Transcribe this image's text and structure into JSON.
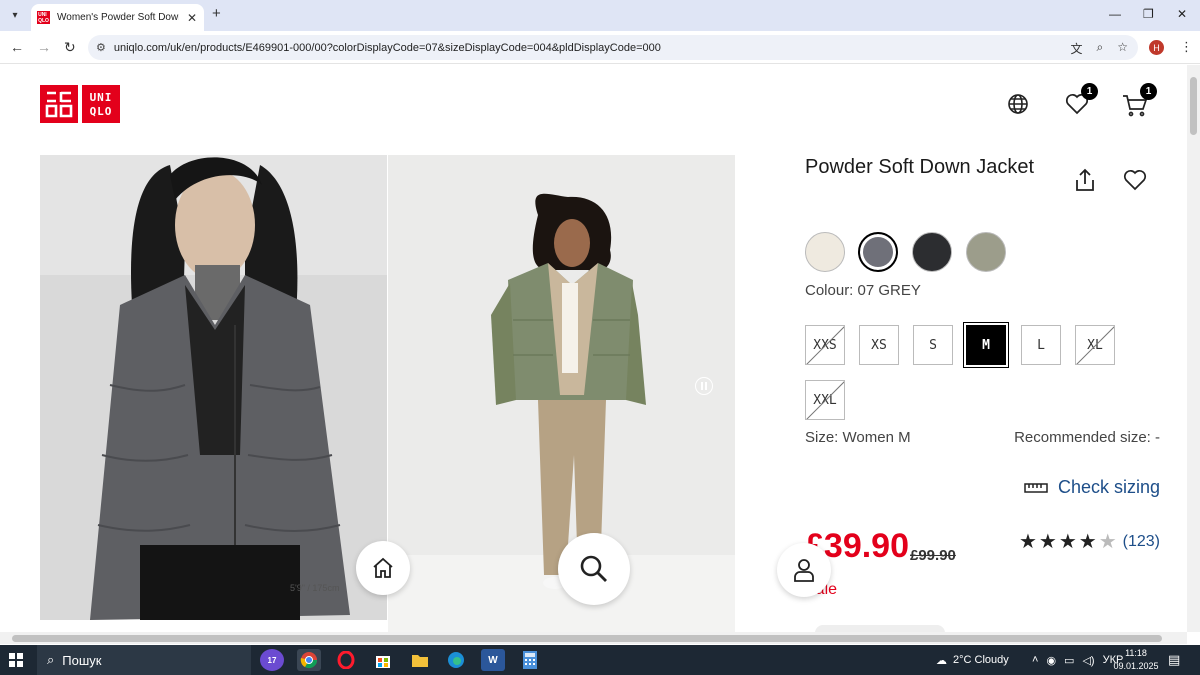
{
  "browser": {
    "tab_title": "Women's Powder Soft Down Ja",
    "url": "uniqlo.com/uk/en/products/E469901-000/00?colorDisplayCode=07&sizeDisplayCode=004&pldDisplayCode=000",
    "profile_initial": "H"
  },
  "header": {
    "logo_left": "ユニ\nクロ",
    "logo_right": "UNI\nQLO",
    "wishlist_count": "1",
    "cart_count": "1"
  },
  "gallery": {
    "model_note": "5'9\" / 175cm"
  },
  "product": {
    "title": "Powder Soft Down Jacket",
    "colour_label": "Colour: 07 GREY",
    "swatches": [
      {
        "name": "off-white",
        "color": "#efeae0"
      },
      {
        "name": "grey",
        "color": "#6f7079"
      },
      {
        "name": "black",
        "color": "#2c2d30"
      },
      {
        "name": "olive",
        "color": "#9c9d8b"
      }
    ],
    "sizes": [
      "XXS",
      "XS",
      "S",
      "M",
      "L",
      "XL",
      "XXL"
    ],
    "size_label": "Size: Women M",
    "recommended_size": "Recommended size: -",
    "check_sizing": "Check sizing",
    "price": "£39.90",
    "old_price": "£99.90",
    "sale": "Sale",
    "rating_count": "(123)",
    "rating_value": 4.5
  },
  "taskbar": {
    "search_placeholder": "Пошук",
    "weather": "2°C  Cloudy",
    "language": "УКР",
    "time": "11:18",
    "date": "09.01.2025",
    "chat_badge": "17"
  }
}
